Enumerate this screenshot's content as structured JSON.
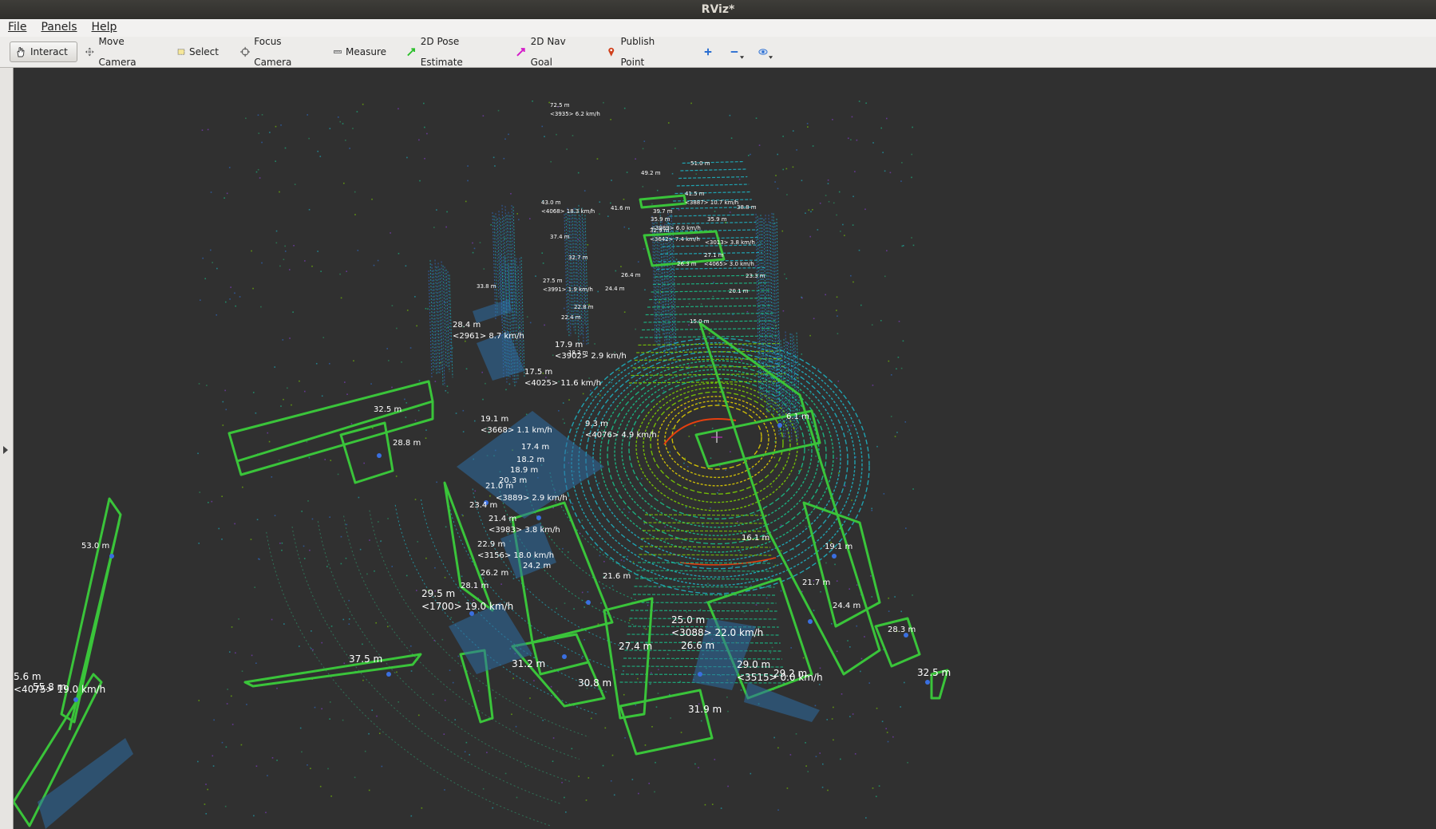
{
  "window": {
    "title": "RViz*"
  },
  "menu": [
    {
      "id": "file",
      "label": "File"
    },
    {
      "id": "panels",
      "label": "Panels"
    },
    {
      "id": "help",
      "label": "Help"
    }
  ],
  "toolbar": {
    "tools": [
      {
        "id": "interact",
        "label": "Interact",
        "icon": "hand-icon",
        "active": true
      },
      {
        "id": "move-camera",
        "label": "Move Camera",
        "icon": "move-icon"
      },
      {
        "id": "select",
        "label": "Select",
        "icon": "select-box-icon"
      },
      {
        "id": "focus-camera",
        "label": "Focus Camera",
        "icon": "crosshair-icon"
      },
      {
        "id": "measure",
        "label": "Measure",
        "icon": "ruler-icon"
      },
      {
        "id": "2d-pose-estimate",
        "label": "2D Pose Estimate",
        "icon": "green-arrow-icon"
      },
      {
        "id": "2d-nav-goal",
        "label": "2D Nav Goal",
        "icon": "magenta-arrow-icon"
      },
      {
        "id": "publish-point",
        "label": "Publish Point",
        "icon": "map-pin-icon"
      }
    ],
    "extra_buttons": [
      "add-tool-icon",
      "remove-tool-icon",
      "camera-type-icon"
    ]
  },
  "colors": {
    "bbox": "#3ac43a",
    "box_fill": "#2e6da4",
    "ring_hot": "#e8d400",
    "ring_warm": "#7fd300",
    "ring_cool": "#19c48c",
    "ring_cold": "#1db6c7",
    "accent_red": "#e6400f",
    "background": "#303030"
  },
  "scene": {
    "labels": [
      {
        "line1": "72.5 m",
        "line2": "<3935> 6.2 km/h",
        "size": "tiny"
      },
      {
        "line1": "49.2 m",
        "size": "tiny"
      },
      {
        "line1": "51.0 m",
        "size": "tiny"
      },
      {
        "line1": "41.5 m",
        "line2": "<3887> 10.7 km/h",
        "size": "tiny"
      },
      {
        "line1": "43.0 m",
        "line2": "<4068> 18.3 km/h",
        "size": "tiny"
      },
      {
        "line1": "41.6 m",
        "size": "tiny"
      },
      {
        "line1": "39.7 m",
        "size": "tiny"
      },
      {
        "line1": "38.8 m",
        "size": "tiny"
      },
      {
        "line1": "35.9 m",
        "line2": "<3989> 6.0 km/h",
        "size": "tiny"
      },
      {
        "line1": "35.9 m",
        "size": "tiny"
      },
      {
        "line1": "32.9 m",
        "line2": "<3642> 7.4 km/h",
        "size": "tiny"
      },
      {
        "line1": "<3013> 3.8 km/h",
        "size": "tiny"
      },
      {
        "line1": "37.4 m",
        "size": "tiny"
      },
      {
        "line1": "32.7 m",
        "size": "tiny"
      },
      {
        "line1": "27.1 m",
        "line2": "<4065> 3.0 km/h",
        "size": "tiny"
      },
      {
        "line1": "26.3 m",
        "size": "tiny"
      },
      {
        "line1": "26.4 m",
        "size": "tiny"
      },
      {
        "line1": "23.3 m",
        "size": "tiny"
      },
      {
        "line1": "33.8 m",
        "size": "tiny"
      },
      {
        "line1": "27.5 m",
        "line2": "<3991> 1.9 km/h",
        "size": "tiny"
      },
      {
        "line1": "24.4 m",
        "size": "tiny"
      },
      {
        "line1": "20.1 m",
        "size": "tiny"
      },
      {
        "line1": "22.8 m",
        "size": "tiny"
      },
      {
        "line1": "22.4 m",
        "size": "tiny"
      },
      {
        "line1": "15.0 m",
        "size": "tiny"
      },
      {
        "line1": "28.4 m",
        "line2": "<2961> 8.7 km/h",
        "size": "small"
      },
      {
        "line1": "17.9 m",
        "line2": "<3902> 2.9 km/h",
        "size": "small"
      },
      {
        "line1": "18.2 m",
        "size": "tiny"
      },
      {
        "line1": "17.5 m",
        "line2": "<4025> 11.6 km/h",
        "size": "small"
      },
      {
        "line1": "32.5 m",
        "size": "small"
      },
      {
        "line1": "19.1 m",
        "line2": "<3668> 1.1 km/h",
        "size": "small"
      },
      {
        "line1": "9.3 m",
        "line2": "<4076> 4.9 km/h",
        "size": "small"
      },
      {
        "line1": "6.1 m",
        "size": "small"
      },
      {
        "line1": "28.8 m",
        "size": "small"
      },
      {
        "line1": "17.4 m",
        "size": "small"
      },
      {
        "line1": "18.2 m",
        "size": "small"
      },
      {
        "line1": "18.9 m",
        "size": "small"
      },
      {
        "line1": "20.3 m",
        "size": "small"
      },
      {
        "line1": "21.0 m",
        "size": "small"
      },
      {
        "line1": "<3889> 2.9 km/h",
        "size": "small"
      },
      {
        "line1": "23.4 m",
        "size": "small"
      },
      {
        "line1": "21.4 m",
        "line2": "<3983> 3.8 km/h",
        "size": "small"
      },
      {
        "line1": "22.9 m",
        "line2": "<3156> 18.0 km/h",
        "size": "small"
      },
      {
        "line1": "53.0 m",
        "size": "small"
      },
      {
        "line1": "16.1 m",
        "size": "small"
      },
      {
        "line1": "19.1 m",
        "size": "small"
      },
      {
        "line1": "26.2 m",
        "size": "small"
      },
      {
        "line1": "24.2 m",
        "size": "small"
      },
      {
        "line1": "21.6 m",
        "size": "small"
      },
      {
        "line1": "21.7 m",
        "size": "small"
      },
      {
        "line1": "28.1 m",
        "size": "small"
      },
      {
        "line1": "29.5 m",
        "line2": "<1700> 19.0 km/h",
        "size": "normal"
      },
      {
        "line1": "24.4 m",
        "size": "small"
      },
      {
        "line1": "25.0 m",
        "line2": "<3088> 22.0 km/h",
        "size": "normal"
      },
      {
        "line1": "28.3 m",
        "size": "small"
      },
      {
        "line1": "37.5 m",
        "size": "normal"
      },
      {
        "line1": "27.4 m",
        "size": "normal"
      },
      {
        "line1": "26.6 m",
        "size": "normal"
      },
      {
        "line1": "31.2 m",
        "size": "normal"
      },
      {
        "line1": "29.0 m",
        "line2": "<3515> 0.0 km/h",
        "size": "normal"
      },
      {
        "line1": "29.2 m",
        "size": "normal"
      },
      {
        "line1": "32.5 m",
        "size": "normal"
      },
      {
        "line1": "30.8 m",
        "size": "normal"
      },
      {
        "line1": "31.9 m",
        "size": "normal"
      },
      {
        "line1": "5.6 m",
        "line2": "<4075> 19.0 km/h",
        "size": "normal"
      },
      {
        "line1": "55.8 m",
        "size": "normal"
      }
    ]
  }
}
